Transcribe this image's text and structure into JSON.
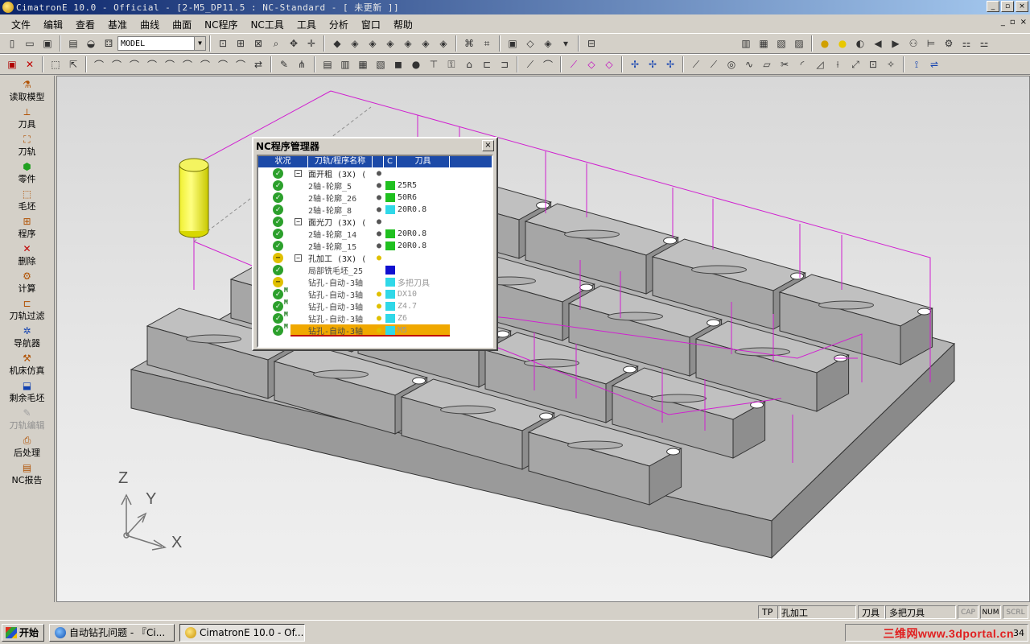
{
  "window": {
    "title": "CimatronE 10.0 - Official - [2-M5_DP11.5 : NC-Standard - [ 未更新 ]]",
    "controls": [
      "_",
      "▫",
      "×"
    ]
  },
  "menu": [
    "文件",
    "编辑",
    "查看",
    "基准",
    "曲线",
    "曲面",
    "NC程序",
    "NC工具",
    "工具",
    "分析",
    "窗口",
    "帮助"
  ],
  "mdi_controls": [
    "_",
    "▫",
    "×"
  ],
  "toolbar": {
    "model_select": "MODEL"
  },
  "left_panel": [
    {
      "label": "读取模型",
      "icon": "read-model-icon"
    },
    {
      "label": "刀具",
      "icon": "tool-icon"
    },
    {
      "label": "刀轨",
      "icon": "toolpath-icon"
    },
    {
      "label": "零件",
      "icon": "part-icon"
    },
    {
      "label": "毛坯",
      "icon": "stock-icon"
    },
    {
      "label": "程序",
      "icon": "program-icon"
    },
    {
      "label": "删除",
      "icon": "delete-icon"
    },
    {
      "label": "计算",
      "icon": "compute-icon"
    },
    {
      "label": "刀轨过滤",
      "icon": "filter-icon"
    },
    {
      "label": "导航器",
      "icon": "navigator-icon"
    },
    {
      "label": "机床仿真",
      "icon": "machine-sim-icon"
    },
    {
      "label": "剩余毛坯",
      "icon": "remaining-stock-icon"
    },
    {
      "label": "刀轨编辑",
      "icon": "toolpath-edit-icon",
      "disabled": true
    },
    {
      "label": "后处理",
      "icon": "post-process-icon"
    },
    {
      "label": "NC报告",
      "icon": "nc-report-icon"
    }
  ],
  "axes": {
    "x": "X",
    "y": "Y",
    "z": "Z"
  },
  "nc_manager": {
    "title": "NC程序管理器",
    "close": "×",
    "headers": {
      "status": "状况",
      "name": "刀轨/程序名称",
      "c": "C",
      "tool": "刀具"
    },
    "rows": [
      {
        "status": "ok",
        "m": false,
        "box": "−",
        "name": "面开粗 (3X) (",
        "bulb": "off",
        "color": "",
        "tool": "",
        "group": true
      },
      {
        "status": "ok",
        "m": false,
        "box": "",
        "name": "2轴-轮廓_5",
        "bulb": "off",
        "color": "#20c020",
        "tool": "25R5",
        "group": false
      },
      {
        "status": "ok",
        "m": false,
        "box": "",
        "name": "2轴-轮廓_26",
        "bulb": "off",
        "color": "#20c020",
        "tool": "50R6",
        "group": false
      },
      {
        "status": "ok",
        "m": false,
        "box": "",
        "name": "2轴-轮廓_8",
        "bulb": "off",
        "color": "#30d8e8",
        "tool": "20R0.8",
        "group": false
      },
      {
        "status": "ok",
        "m": false,
        "box": "−",
        "name": "面光刀 (3X) (",
        "bulb": "off",
        "color": "",
        "tool": "",
        "group": true
      },
      {
        "status": "ok",
        "m": false,
        "box": "",
        "name": "2轴-轮廓_14",
        "bulb": "off",
        "color": "#20c020",
        "tool": "20R0.8",
        "group": false
      },
      {
        "status": "ok",
        "m": false,
        "box": "",
        "name": "2轴-轮廓_15",
        "bulb": "off",
        "color": "#20c020",
        "tool": "20R0.8",
        "group": false
      },
      {
        "status": "warn",
        "m": false,
        "box": "−",
        "name": "孔加工 (3X) (",
        "bulb": "on",
        "color": "",
        "tool": "",
        "group": true
      },
      {
        "status": "ok",
        "m": false,
        "box": "",
        "name": "局部铣毛坯_25",
        "bulb": "",
        "color": "#1010d0",
        "tool": "",
        "group": false
      },
      {
        "status": "warn",
        "m": false,
        "box": "",
        "name": "钻孔-自动-3轴",
        "bulb": "",
        "color": "#30d8e8",
        "tool": "多把刀具",
        "group": false,
        "dim": true
      },
      {
        "status": "ok",
        "m": true,
        "box": "",
        "name": "钻孔-自动-3轴",
        "bulb": "on",
        "color": "#30d8e8",
        "tool": "DX10",
        "group": false,
        "dim": true
      },
      {
        "status": "ok",
        "m": true,
        "box": "",
        "name": "钻孔-自动-3轴",
        "bulb": "on",
        "color": "#30d8e8",
        "tool": "Z4.7",
        "group": false,
        "dim": true
      },
      {
        "status": "ok",
        "m": true,
        "box": "",
        "name": "钻孔-自动-3轴",
        "bulb": "on",
        "color": "#30d8e8",
        "tool": "Z6",
        "group": false,
        "dim": true
      },
      {
        "status": "ok",
        "m": true,
        "box": "",
        "name": "钻孔-自动-3轴",
        "bulb": "on",
        "color": "#30d8e8",
        "tool": "M5",
        "group": false,
        "dim": true,
        "selected": true
      }
    ]
  },
  "status_bar": {
    "tp_label": "TP",
    "tp_value": "孔加工",
    "tool_label": "刀具",
    "tool_value": "多把刀具",
    "cap": "CAP",
    "num": "NUM",
    "scrl": "SCRL"
  },
  "taskbar": {
    "start": "开始",
    "buttons": [
      {
        "label": "自动钻孔问题 - 『Ci...",
        "active": false
      },
      {
        "label": "CimatronE 10.0 - Of...",
        "active": true
      }
    ],
    "clock": "34",
    "watermark": "三维网www.3dportal.cn"
  }
}
